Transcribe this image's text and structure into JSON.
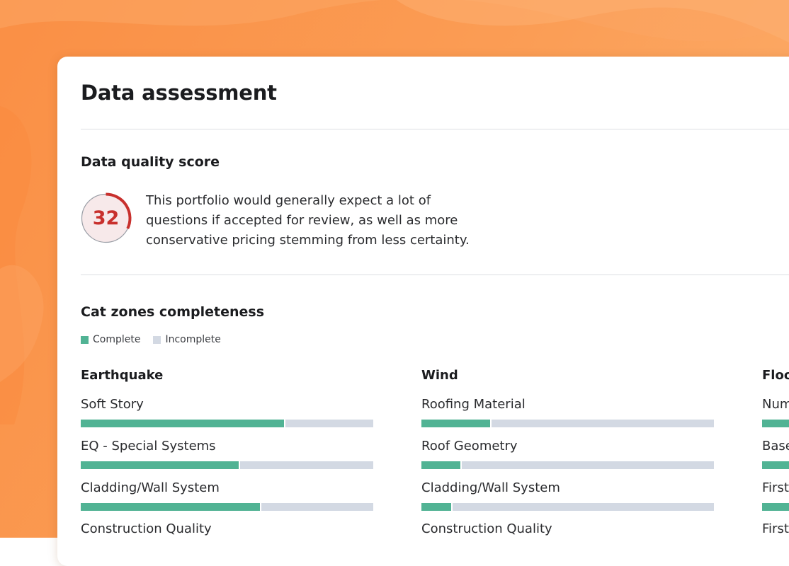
{
  "header": {
    "title": "Data assessment"
  },
  "quality": {
    "heading": "Data quality score",
    "score": "32",
    "description": "This portfolio would generally expect a lot of\nquestions if accepted for review, as well as more\nconservative pricing stemming from less certainty."
  },
  "cat_zones": {
    "heading": "Cat zones completeness",
    "legend": {
      "complete": "Complete",
      "incomplete": "Incomplete"
    },
    "colors": {
      "complete": "#51b394",
      "incomplete": "#d3d9e3",
      "score_accent": "#c8302d"
    },
    "columns": [
      {
        "title": "Earthquake",
        "metrics": [
          {
            "label": "Soft Story",
            "complete_pct": 69.6
          },
          {
            "label": "EQ - Special Systems",
            "complete_pct": 54
          },
          {
            "label": "Cladding/Wall System",
            "complete_pct": 61.3
          },
          {
            "label": "Construction Quality"
          }
        ]
      },
      {
        "title": "Wind",
        "metrics": [
          {
            "label": "Roofing Material",
            "complete_pct": 23.5
          },
          {
            "label": "Roof Geometry",
            "complete_pct": 13.3
          },
          {
            "label": "Cladding/Wall System",
            "complete_pct": 10.2
          },
          {
            "label": "Construction Quality"
          }
        ]
      },
      {
        "title": "Floo",
        "metrics": [
          {
            "label": "Num",
            "complete_pct": 12
          },
          {
            "label": "Base",
            "complete_pct": 12
          },
          {
            "label": "First",
            "complete_pct": 12
          },
          {
            "label": "First"
          }
        ]
      }
    ]
  }
}
